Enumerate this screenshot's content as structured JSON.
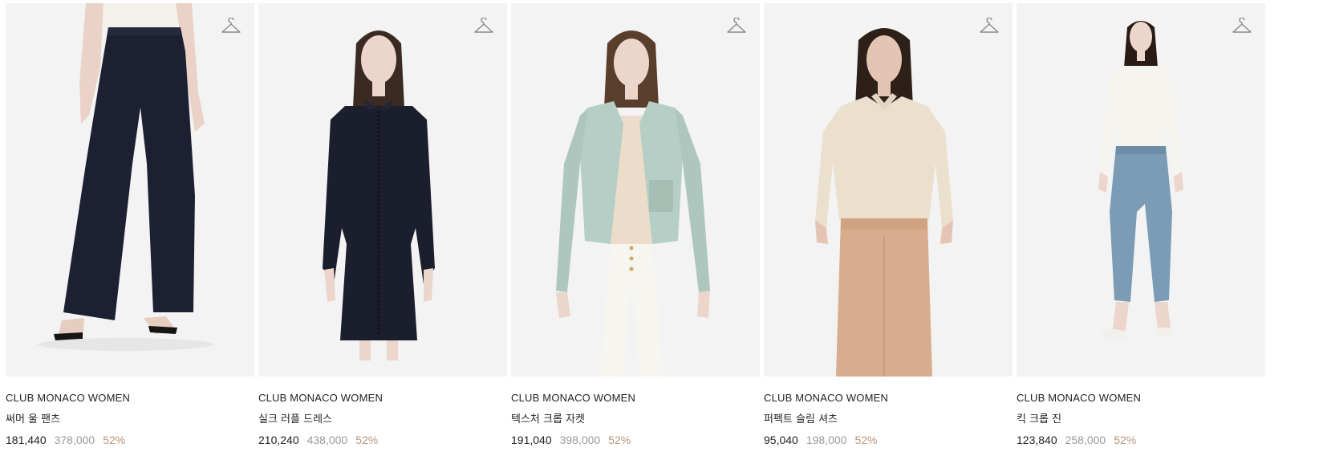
{
  "products": [
    {
      "brand": "CLUB MONACO WOMEN",
      "name": "써머 울 팬츠",
      "sale_price": "181,440",
      "original_price": "378,000",
      "discount": "52%",
      "wishlist_icon": "hanger-icon",
      "image": "model-navy-wide-pants"
    },
    {
      "brand": "CLUB MONACO WOMEN",
      "name": "실크 러플 드레스",
      "sale_price": "210,240",
      "original_price": "438,000",
      "discount": "52%",
      "wishlist_icon": "hanger-icon",
      "image": "model-navy-silk-dress"
    },
    {
      "brand": "CLUB MONACO WOMEN",
      "name": "텍스처 크롭 자켓",
      "sale_price": "191,040",
      "original_price": "398,000",
      "discount": "52%",
      "wishlist_icon": "hanger-icon",
      "image": "model-mint-crop-jacket"
    },
    {
      "brand": "CLUB MONACO WOMEN",
      "name": "퍼펙트 슬림 셔츠",
      "sale_price": "95,040",
      "original_price": "198,000",
      "discount": "52%",
      "wishlist_icon": "hanger-icon",
      "image": "model-beige-shirt"
    },
    {
      "brand": "CLUB MONACO WOMEN",
      "name": "킥 크롭 진",
      "sale_price": "123,840",
      "original_price": "258,000",
      "discount": "52%",
      "wishlist_icon": "hanger-icon",
      "image": "model-blue-crop-jeans"
    }
  ],
  "colors": {
    "discount": "#b8957a",
    "original_price": "#9a9a9a",
    "text": "#222222"
  }
}
